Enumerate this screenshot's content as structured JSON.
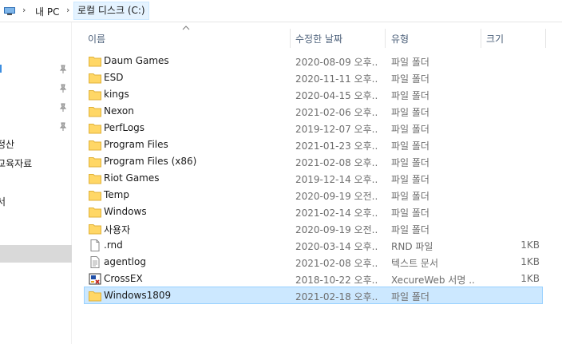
{
  "address": {
    "crumbs": [
      "내 PC",
      "로컬 디스크 (C:)"
    ]
  },
  "nav": {
    "items": [
      {
        "label": "",
        "pinned": true
      },
      {
        "label": "",
        "pinned": true
      },
      {
        "label": "",
        "pinned": true
      },
      {
        "label": "",
        "pinned": true
      },
      {
        "label": "정산",
        "pinned": false
      },
      {
        "label": "교육자료",
        "pinned": false
      },
      {
        "label": "서",
        "pinned": false
      },
      {
        "label": "",
        "pinned": false,
        "selected": true
      }
    ]
  },
  "columns": {
    "name": "이름",
    "date": "수정한 날짜",
    "type": "유형",
    "size": "크기"
  },
  "files": [
    {
      "name": "Daum Games",
      "date": "2020-08-09 오후...",
      "type": "파일 폴더",
      "size": "",
      "icon": "folder-icon"
    },
    {
      "name": "ESD",
      "date": "2020-11-11 오후...",
      "type": "파일 폴더",
      "size": "",
      "icon": "folder-icon"
    },
    {
      "name": "kings",
      "date": "2020-04-15 오후...",
      "type": "파일 폴더",
      "size": "",
      "icon": "folder-icon"
    },
    {
      "name": "Nexon",
      "date": "2021-02-06 오후...",
      "type": "파일 폴더",
      "size": "",
      "icon": "folder-icon"
    },
    {
      "name": "PerfLogs",
      "date": "2019-12-07 오후...",
      "type": "파일 폴더",
      "size": "",
      "icon": "folder-icon"
    },
    {
      "name": "Program Files",
      "date": "2021-01-23 오후...",
      "type": "파일 폴더",
      "size": "",
      "icon": "folder-icon"
    },
    {
      "name": "Program Files (x86)",
      "date": "2021-02-08 오후...",
      "type": "파일 폴더",
      "size": "",
      "icon": "folder-icon"
    },
    {
      "name": "Riot Games",
      "date": "2019-12-14 오후...",
      "type": "파일 폴더",
      "size": "",
      "icon": "folder-icon"
    },
    {
      "name": "Temp",
      "date": "2020-09-19 오전...",
      "type": "파일 폴더",
      "size": "",
      "icon": "folder-icon"
    },
    {
      "name": "Windows",
      "date": "2021-02-14 오후...",
      "type": "파일 폴더",
      "size": "",
      "icon": "folder-icon"
    },
    {
      "name": "사용자",
      "date": "2020-09-19 오전...",
      "type": "파일 폴더",
      "size": "",
      "icon": "folder-icon"
    },
    {
      "name": ".rnd",
      "date": "2020-03-14 오후...",
      "type": "RND 파일",
      "size": "1KB",
      "icon": "blank-file-icon"
    },
    {
      "name": "agentlog",
      "date": "2021-02-08 오후...",
      "type": "텍스트 문서",
      "size": "1KB",
      "icon": "text-file-icon"
    },
    {
      "name": "CrossEX",
      "date": "2018-10-22 오후...",
      "type": "XecureWeb 서명 ...",
      "size": "1KB",
      "icon": "certificate-file-icon"
    },
    {
      "name": "Windows1809",
      "date": "2021-02-18 오후...",
      "type": "파일 폴더",
      "size": "",
      "icon": "folder-icon",
      "selected": true
    }
  ],
  "colors": {
    "selection_bg": "#cce8ff",
    "selection_border": "#99d1ff",
    "folder_yellow": "#ffd766",
    "header_text": "#4c607a"
  }
}
